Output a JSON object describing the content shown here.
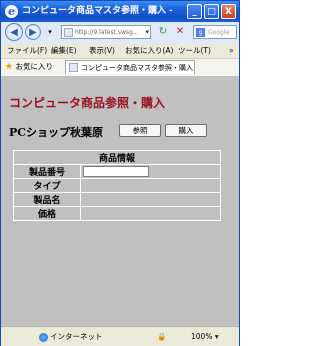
{
  "window": {
    "title": "コンピュータ商品マスタ参照・購入 - Windows Internet Explorer",
    "title_icon": "e",
    "minimize": "_",
    "maximize": "□",
    "close": "X"
  },
  "nav": {
    "back": "◀",
    "forward": "▶",
    "address": "http://9.latest.swsg...",
    "address_dropdown": "▾",
    "refresh": "↻",
    "stop": "✕",
    "search_engine": "Google",
    "search_logo": "g"
  },
  "menu": {
    "file": "ファイル(F)",
    "edit": "編集(E)",
    "view": "表示(V)",
    "favorites": "お気に入り(A)",
    "tools": "ツール(T)",
    "more": "»"
  },
  "favbar": {
    "favorites_label": "お気に入り",
    "star": "★",
    "tab_title": "コンピュータ商品マスタ参照・購入"
  },
  "page": {
    "heading": "コンピュータ商品参照・購入",
    "shop_name": "PCショップ秋葉原",
    "reference_button": "参照",
    "purchase_button": "購入",
    "table": {
      "header": "商品情報",
      "rows": [
        {
          "label": "製品番号",
          "input_value": ""
        },
        {
          "label": "タイプ",
          "value": ""
        },
        {
          "label": "製品名",
          "value": ""
        },
        {
          "label": "価格",
          "value": ""
        }
      ]
    }
  },
  "status": {
    "zone": "インターネット",
    "zoom": "100%",
    "zoom_caret": "▾",
    "protected_icon": "🔒"
  }
}
